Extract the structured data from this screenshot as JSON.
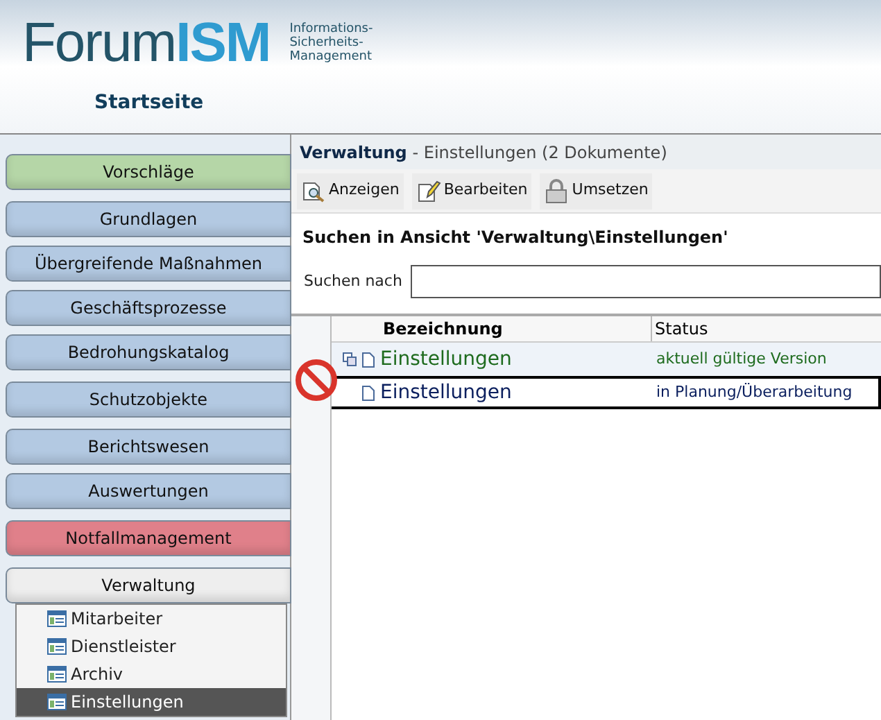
{
  "header": {
    "logo_dark": "Forum",
    "logo_light": "ISM",
    "tagline": [
      "Informations-",
      "Sicherheits-",
      "Management"
    ],
    "home_link": "Startseite"
  },
  "sidebar": {
    "items": [
      {
        "label": "Vorschläge",
        "color": "#b5d6a7"
      },
      {
        "label": "Grundlagen",
        "color": "#b3c9e2"
      },
      {
        "label": "Übergreifende Maßnahmen",
        "color": "#b3c9e2"
      },
      {
        "label": "Geschäftsprozesse",
        "color": "#b3c9e2"
      },
      {
        "label": "Bedrohungskatalog",
        "color": "#b3c9e2"
      },
      {
        "label": "Schutzobjekte",
        "color": "#b3c9e2"
      },
      {
        "label": "Berichtswesen",
        "color": "#b3c9e2"
      },
      {
        "label": "Auswertungen",
        "color": "#b3c9e2"
      },
      {
        "label": "Notfallmanagement",
        "color": "#e0808a"
      },
      {
        "label": "Verwaltung",
        "color": "#eeeeee",
        "expanded": true,
        "children": [
          {
            "label": "Mitarbeiter",
            "selected": false
          },
          {
            "label": "Dienstleister",
            "selected": false
          },
          {
            "label": "Archiv",
            "selected": false
          },
          {
            "label": "Einstellungen",
            "selected": true
          }
        ]
      }
    ]
  },
  "main": {
    "title_bold": "Verwaltung",
    "title_rest": " - Einstellungen (2 Dokumente)",
    "toolbar": [
      {
        "label": "Anzeigen",
        "kind": "view"
      },
      {
        "label": "Bearbeiten",
        "kind": "edit"
      },
      {
        "label": "Umsetzen",
        "kind": "lock"
      }
    ],
    "search": {
      "heading": "Suchen in Ansicht 'Verwaltung\\Einstellungen'",
      "label": "Suchen nach"
    },
    "table": {
      "columns": [
        "Bezeichnung",
        "Status"
      ],
      "rows": [
        {
          "name": "Einstellungen",
          "status": "aktuell gültige Version",
          "color": "#1e6b1e",
          "has_versions": true,
          "blocked": false,
          "selected": false
        },
        {
          "name": "Einstellungen",
          "status": "in Planung/Überarbeitung",
          "color": "#0b1f5e",
          "has_versions": false,
          "blocked": true,
          "selected": true
        }
      ]
    }
  }
}
